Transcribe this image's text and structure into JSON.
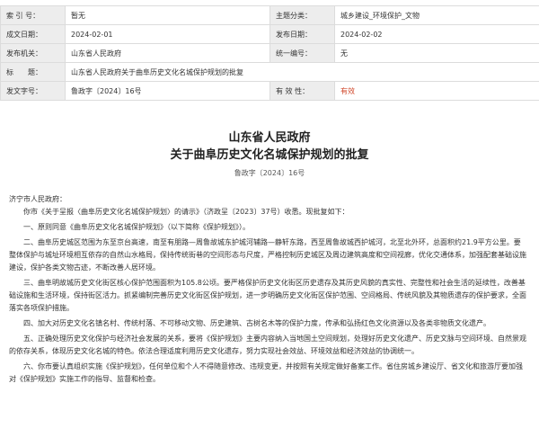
{
  "meta": {
    "rows": [
      [
        {
          "label": "索 引 号：",
          "value": "暂无"
        },
        {
          "label": "主题分类：",
          "value": "城乡建设_环境保护_文物"
        }
      ],
      [
        {
          "label": "成文日期：",
          "value": "2024-02-01"
        },
        {
          "label": "发布日期：",
          "value": "2024-02-02"
        }
      ],
      [
        {
          "label": "发布机关：",
          "value": "山东省人民政府"
        },
        {
          "label": "统一编号：",
          "value": "无"
        }
      ],
      [
        {
          "label": "标　　题：",
          "value": "山东省人民政府关于曲阜历史文化名城保护规划的批复"
        }
      ],
      [
        {
          "label": "发文字号：",
          "value": "鲁政字〔2024〕16号"
        },
        {
          "label": "有 效 性：",
          "value": "有效"
        }
      ]
    ],
    "valid_color": "#d0472a"
  },
  "doc": {
    "title1": "山东省人民政府",
    "title2": "关于曲阜历史文化名城保护规划的批复",
    "doc_no": "鲁政字〔2024〕16号",
    "salutation": "济宁市人民政府：",
    "paragraphs": [
      "你市《关于呈报〈曲阜历史文化名城保护规划〉的请示》（济政呈〔2023〕37号）收悉。现批复如下：",
      "一、原则同意《曲阜历史文化名城保护规划》（以下简称《保护规划》）。",
      "二、曲阜历史城区范围为东至京台高速，南至有朋路—周鲁故城东护城河辅路—静轩东路，西至周鲁故城西护城河，北至北外环，总面积约21.9平方公里。要整体保护与城址环境相互依存的自然山水格局，保持传统街巷的空间形态与尺度，严格控制历史城区及周边建筑高度和空间视廊，优化交通体系，加强配套基础设施建设，保护各类文物古迹，不断改善人居环境。",
      "三、曲阜明故城历史文化街区核心保护范围面积为105.8公顷。要严格保护历史文化街区历史遗存及其历史风貌的真实性、完整性和社会生活的延续性，改善基础设施和生活环境，保持街区活力。抓紧编制完善历史文化街区保护规划，进一步明确历史文化街区保护范围、空间格局、传统风貌及其物质遗存的保护要求，全面落实各项保护措施。",
      "四、加大对历史文化名镇名村、传统村落、不可移动文物、历史建筑、古树名木等的保护力度，传承和弘扬红色文化资源以及各类非物质文化遗产。",
      "五、正确处理历史文化保护与经济社会发展的关系，要将《保护规划》主要内容纳入当地国土空间规划，处理好历史文化遗产、历史文脉与空间环境、自然景观的依存关系，体现历史文化名城的特色。依法合理适度利用历史文化遗存，努力实现社会效益、环境效益和经济效益的协调统一。",
      "六、你市要认真组织实施《保护规划》，任何单位和个人不得随意修改、违规变更，并按照有关规定做好备案工作。省住房城乡建设厅、省文化和旅游厅要加强对《保护规划》实施工作的指导、监督和检查。"
    ]
  }
}
